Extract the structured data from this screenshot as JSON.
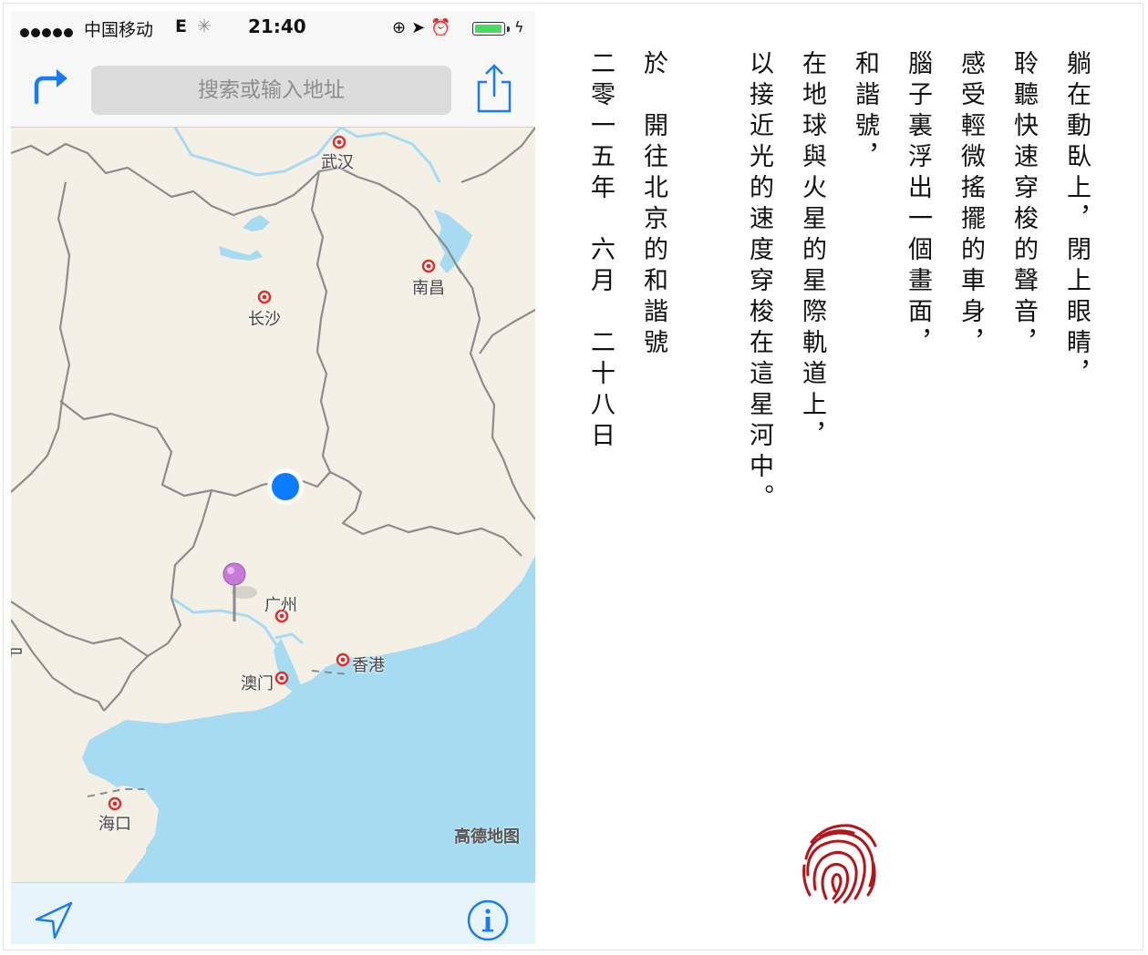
{
  "status_bar": {
    "carrier": "中国移动",
    "network": "E",
    "time": "21:40"
  },
  "nav": {
    "search_placeholder": "搜索或输入地址"
  },
  "map": {
    "labels": {
      "wuhan": "武汉",
      "nanchang": "南昌",
      "changsha": "长沙",
      "guangzhou": "广州",
      "hongkong": "香港",
      "macau": "澳门",
      "haikou": "海口",
      "edge_partial": "尸"
    },
    "provider": "高德地图",
    "colors": {
      "land": "#f4f0e6",
      "water": "#a6dbf2",
      "border": "#8c8c8c",
      "user_dot": "#0a7cff",
      "pin": "#c57bd6",
      "city_marker": "#d9322e"
    }
  },
  "poem": {
    "lines": [
      "躺在動臥上，閉上眼睛，",
      "聆聽快速穿梭的聲音，",
      "感受輕微搖擺的車身，",
      "腦子裏浮出一個畫面，",
      "和諧號，",
      "在地球與火星的星際軌道上，",
      "以接近光的速度穿梭在這星河中。",
      "",
      "於　開往北京的和諧號",
      "二零一五年　六月　二十八日"
    ]
  },
  "icons": {
    "directions": "directions-arrow-icon",
    "share": "share-icon",
    "locate": "location-arrow-icon",
    "info": "info-icon",
    "fingerprint": "fingerprint-icon"
  }
}
